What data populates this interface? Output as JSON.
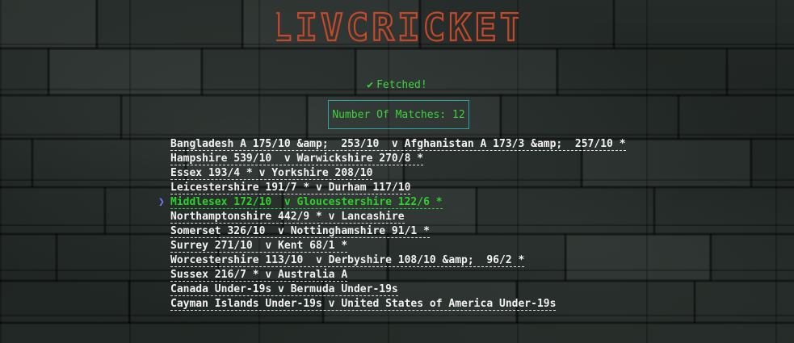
{
  "app": {
    "logo_text": "LIVCRICKET",
    "logo_color": "#c2492a"
  },
  "status": {
    "icon": "check-icon",
    "text": "Fetched!",
    "color": "#3ed23e"
  },
  "count_box": {
    "text": "Number Of Matches: 12",
    "border_color": "#2aa3a3"
  },
  "pointer": {
    "glyph": "❯",
    "icon": "chevron-right-icon",
    "selected_index": 4
  },
  "matches": [
    "Bangladesh A 175/10 &amp;  253/10  v Afghanistan A 173/3 &amp;  257/10 *",
    "Hampshire 539/10  v Warwickshire 270/8 *",
    "Essex 193/4 * v Yorkshire 208/10",
    "Leicestershire 191/7 * v Durham 117/10",
    "Middlesex 172/10  v Gloucestershire 122/6 *",
    "Northamptonshire 442/9 * v Lancashire",
    "Somerset 326/10  v Nottinghamshire 91/1 *",
    "Surrey 271/10  v Kent 68/1 *",
    "Worcestershire 113/10  v Derbyshire 108/10 &amp;  96/2 *",
    "Sussex 216/7 * v Australia A",
    "Canada Under-19s v Bermuda Under-19s",
    "Cayman Islands Under-19s v United States of America Under-19s"
  ]
}
